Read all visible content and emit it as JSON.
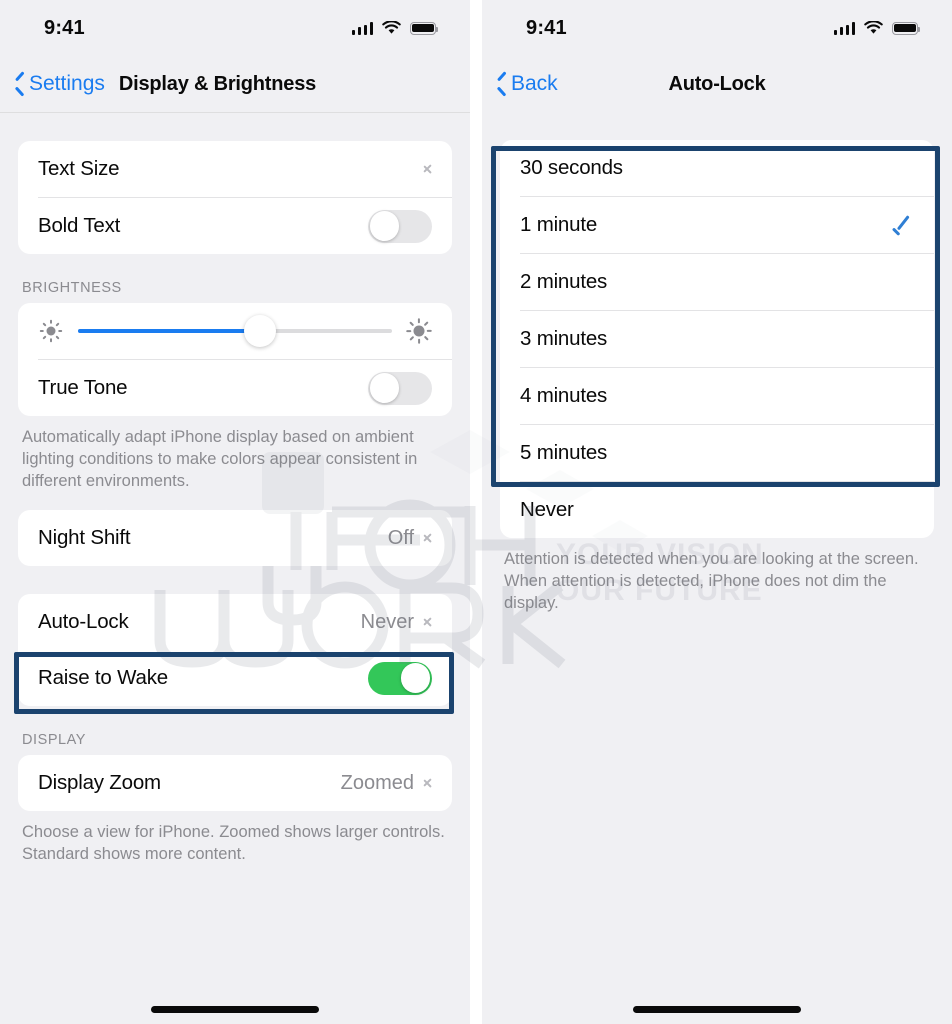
{
  "colors": {
    "accent_blue": "#1a7cf0",
    "toggle_green": "#33c759",
    "highlight_navy": "#1b436e",
    "check_blue": "#2f7fd4",
    "page_bg": "#f0f0f3",
    "card_bg": "#ffffff",
    "secondary_text": "#8b8b90"
  },
  "watermark": {
    "brand": "TECH",
    "brand2": "WORK",
    "tagline_line1": "YOUR VISION",
    "tagline_line2": "OUR FUTURE"
  },
  "left_panel": {
    "status": {
      "time": "9:41",
      "signal_icon": "cellular-bars-icon",
      "wifi_icon": "wifi-icon",
      "battery_icon": "battery-full-icon"
    },
    "nav": {
      "back_label": "Settings",
      "back_icon": "chevron-left-icon",
      "title": "Display & Brightness"
    },
    "group1": {
      "rows": [
        {
          "label": "Text Size",
          "value": "",
          "accessory": "chevron",
          "icon": "chevron-right-icon"
        },
        {
          "label": "Bold Text",
          "value": "",
          "accessory": "toggle",
          "toggle_on": false,
          "icon": "toggle-off-icon"
        }
      ]
    },
    "brightness": {
      "header": "BRIGHTNESS",
      "slider": {
        "value_percent": 58,
        "min_icon": "brightness-low-icon",
        "max_icon": "brightness-high-icon"
      },
      "true_tone": {
        "label": "True Tone",
        "toggle_on": false,
        "icon": "toggle-off-icon"
      },
      "footnote": "Automatically adapt iPhone display based on ambient lighting conditions to make colors appear consistent in different environments."
    },
    "night_shift": {
      "label": "Night Shift",
      "value": "Off",
      "icon": "chevron-right-icon"
    },
    "lock_group": {
      "rows": [
        {
          "label": "Auto-Lock",
          "value": "Never",
          "accessory": "chevron",
          "icon": "chevron-right-icon",
          "highlighted": true
        },
        {
          "label": "Raise to Wake",
          "value": "",
          "accessory": "toggle",
          "toggle_on": true,
          "icon": "toggle-on-icon"
        }
      ]
    },
    "display": {
      "header": "DISPLAY",
      "row": {
        "label": "Display Zoom",
        "value": "Zoomed",
        "icon": "chevron-right-icon"
      },
      "footnote": "Choose a view for iPhone. Zoomed shows larger controls. Standard shows more content."
    }
  },
  "right_panel": {
    "status": {
      "time": "9:41",
      "signal_icon": "cellular-bars-icon",
      "wifi_icon": "wifi-icon",
      "battery_icon": "battery-full-icon"
    },
    "nav": {
      "back_label": "Back",
      "back_icon": "chevron-left-icon",
      "title": "Auto-Lock"
    },
    "options": [
      {
        "label": "30 seconds",
        "selected": false
      },
      {
        "label": "1 minute",
        "selected": true
      },
      {
        "label": "2 minutes",
        "selected": false
      },
      {
        "label": "3 minutes",
        "selected": false
      },
      {
        "label": "4 minutes",
        "selected": false
      },
      {
        "label": "5 minutes",
        "selected": false
      },
      {
        "label": "Never",
        "selected": false
      }
    ],
    "selected_value": "1 minute",
    "footnote": "Attention is detected when you are looking at the screen. When attention is detected, iPhone does not dim the display."
  }
}
